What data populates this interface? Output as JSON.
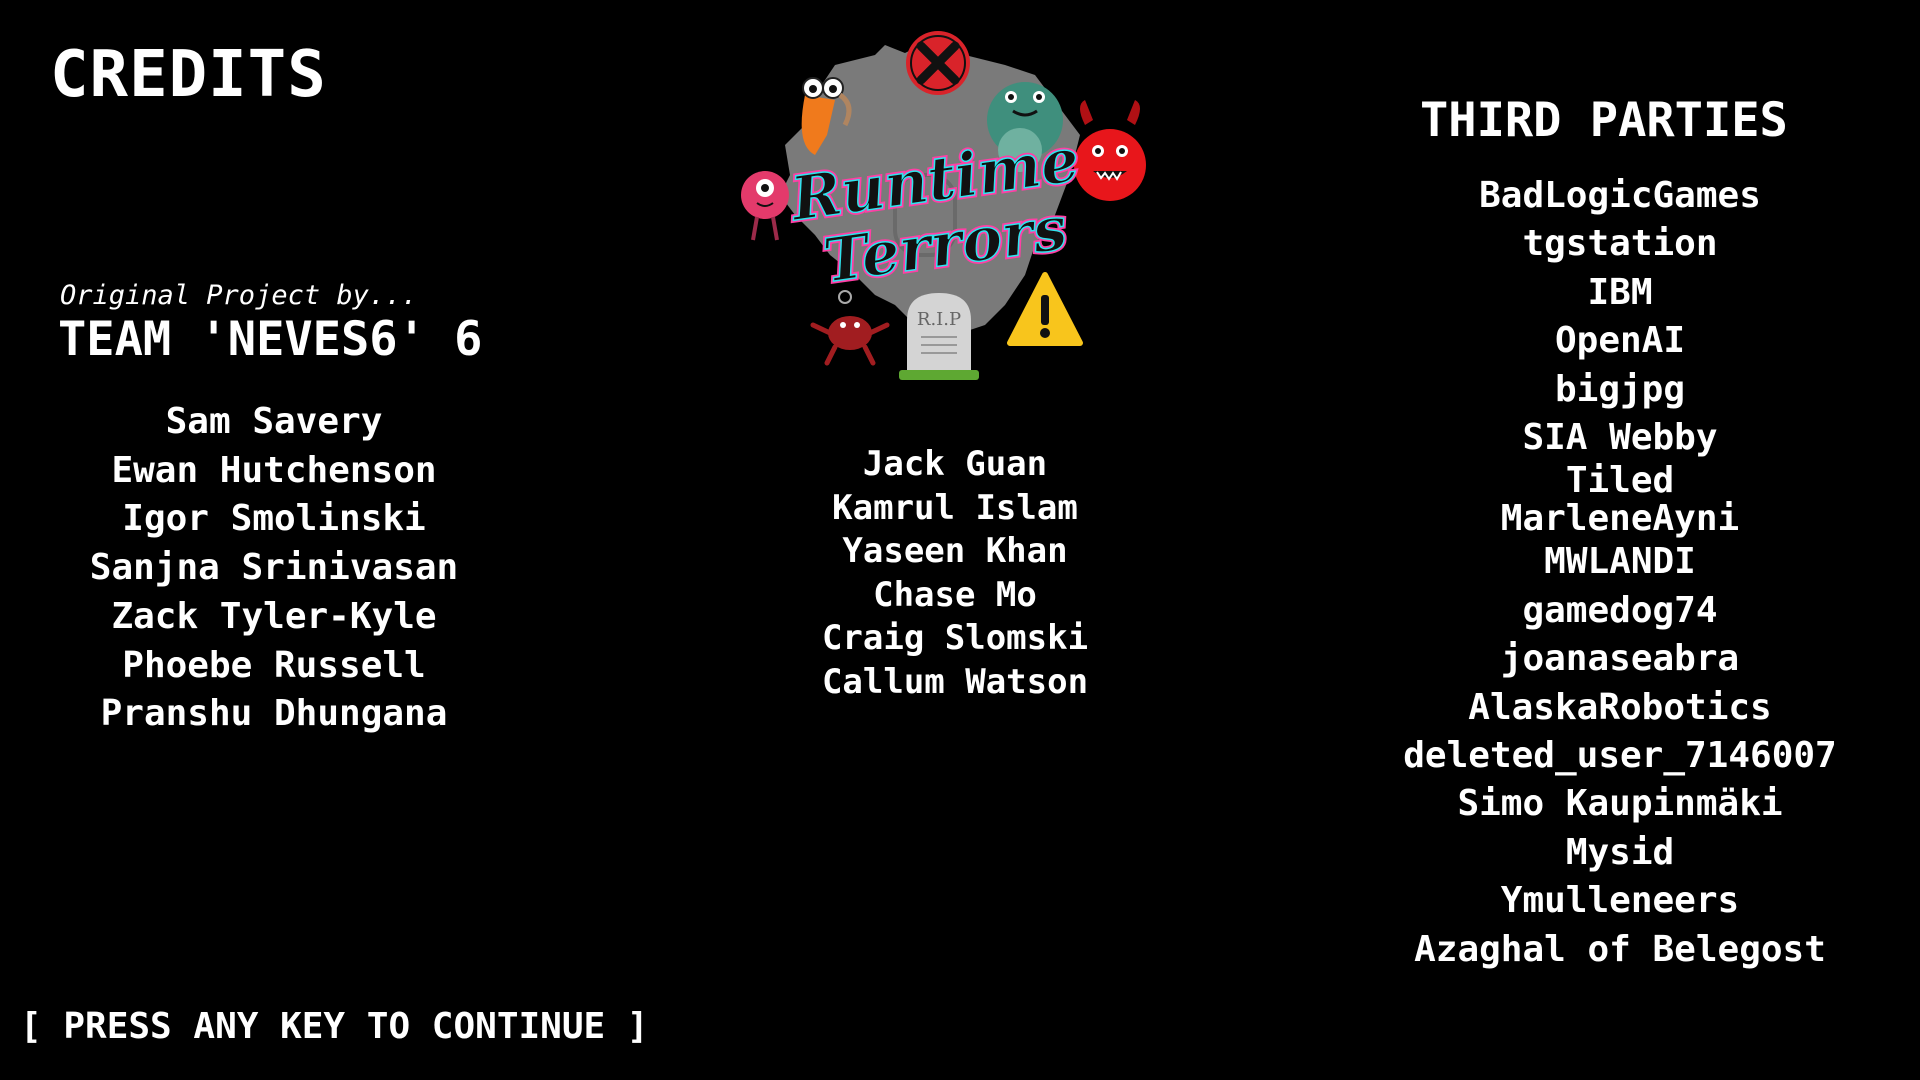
{
  "screen": {
    "title": "CREDITS",
    "original_project_label": "Original Project by...",
    "original_team": "TEAM 'NEVES6' 6",
    "original_members": [
      "Sam Savery",
      "Ewan Hutchenson",
      "Igor Smolinski",
      "Sanjna Srinivasan",
      "Zack Tyler-Kyle",
      "Phoebe Russell",
      "Pranshu Dhungana"
    ],
    "logo": {
      "line1": "Runtime",
      "line2": "Terrors",
      "tombstone_text": "R.I.P"
    },
    "runtime_terrors_members": [
      "Jack Guan",
      "Kamrul Islam",
      "Yaseen Khan",
      "Chase Mo",
      "Craig Slomski",
      "Callum Watson"
    ],
    "third_parties_heading": "THIRD PARTIES",
    "third_parties": [
      "BadLogicGames",
      "tgstation",
      "IBM",
      "OpenAI",
      "bigjpg",
      "SIA Webby",
      "Tiled",
      "MarleneAyni",
      "MWLANDI",
      "gamedog74",
      "joanaseabra",
      "AlaskaRobotics",
      "deleted_user_7146007",
      "Simo Kaupinmäki",
      "Mysid",
      "Ymulleneers",
      "Azaghal of Belegost"
    ],
    "continue_prompt": "[ PRESS ANY KEY TO CONTINUE ]"
  },
  "colors": {
    "background": "#000000",
    "text": "#ffffff",
    "logo_splash": "#7a7a7a",
    "logo_text": "#111111",
    "logo_glow_pink": "#ff3fa4",
    "logo_glow_cyan": "#2fe4ee",
    "monster_red": "#e8161b",
    "monster_orange": "#f07a1c",
    "monster_teal": "#3f8f7d",
    "monster_pink": "#e33a6b",
    "warning_yellow": "#f8c51c",
    "tombstone_grass": "#5ea832"
  }
}
